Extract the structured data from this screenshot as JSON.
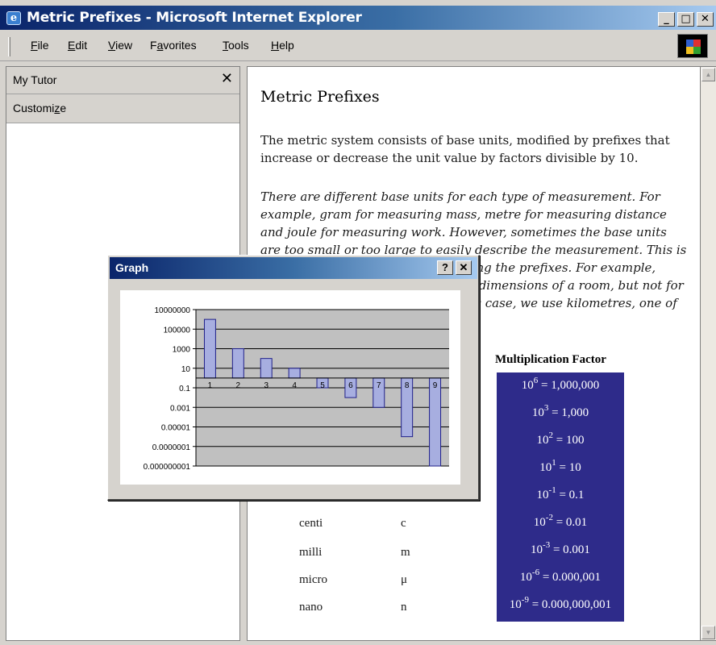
{
  "window": {
    "title": "Metric Prefixes - Microsoft Internet Explorer",
    "minimize_label": "_",
    "maximize_label": "□",
    "close_label": "✕"
  },
  "menu": {
    "items": [
      {
        "key": "F",
        "rest": "ile"
      },
      {
        "key": "E",
        "rest": "dit"
      },
      {
        "key": "V",
        "rest": "iew"
      },
      {
        "pre": "F",
        "key": "a",
        "rest": "vorites"
      },
      {
        "key": "T",
        "rest": "ools"
      },
      {
        "key": "H",
        "rest": "elp"
      }
    ]
  },
  "sidebar": {
    "title": "My Tutor",
    "close_label": "✕",
    "customize_pre": "Customi",
    "customize_key": "z",
    "customize_post": "e"
  },
  "page": {
    "title": "Metric Prefixes",
    "paragraph1": "The metric system consists of base units, modified by prefixes that increase or decrease the unit value by factors divisible by 10.",
    "paragraph2": "There are different base units for each type of measurement. For example, gram for measuring mass, metre for measuring distance and joule for measuring work. However, sometimes the base units are too small or too large to easily describe the measurement. This is when we modify the base units, using the prefixes. For example, metres are good for measuring the dimensions of a room, but not for the distances between cities. In this case, we use kilometres, one of which is 1000 metres.",
    "factor_header": "Multiplication Factor",
    "factors": [
      {
        "power": "6",
        "value": " = 1,000,000"
      },
      {
        "power": "3",
        "value": " = 1,000"
      },
      {
        "power": "2",
        "value": " = 100"
      },
      {
        "power": "1",
        "value": " = 10"
      },
      {
        "power": "-1",
        "value": " = 0.1"
      },
      {
        "power": "-2",
        "value": " = 0.01"
      },
      {
        "power": "-3",
        "value": " = 0.001"
      },
      {
        "power": "-6",
        "value": " = 0.000,001"
      },
      {
        "power": "-9",
        "value": " = 0.000,000,001"
      }
    ],
    "factor_base": "10",
    "prefixes": [
      {
        "name": "centi",
        "symbol": "c"
      },
      {
        "name": "milli",
        "symbol": "m"
      },
      {
        "name": "micro",
        "symbol": "μ"
      },
      {
        "name": "nano",
        "symbol": "n"
      }
    ]
  },
  "graph": {
    "title": "Graph",
    "help_label": "?",
    "close_label": "✕",
    "colors": {
      "bar": "#a7aee0",
      "plot_bg": "#c0c0c0",
      "bar_border": "#20208a"
    }
  },
  "chart_data": {
    "type": "bar",
    "log_scale": true,
    "categories": [
      "1",
      "2",
      "3",
      "4",
      "5",
      "6",
      "7",
      "8",
      "9"
    ],
    "values": [
      1000000,
      1000,
      100,
      10,
      0.1,
      0.01,
      0.001,
      1e-06,
      1e-09
    ],
    "ytick_labels": [
      "10000000",
      "100000",
      "1000",
      "10",
      "0.1",
      "0.001",
      "0.00001",
      "0.0000001",
      "0.000000001"
    ],
    "ytick_values": [
      10000000,
      100000,
      1000,
      10,
      0.1,
      0.001,
      1e-05,
      1e-07,
      1e-09
    ],
    "ylim": [
      1e-09,
      10000000
    ],
    "baseline": 1,
    "grid": true,
    "legend": "none"
  }
}
